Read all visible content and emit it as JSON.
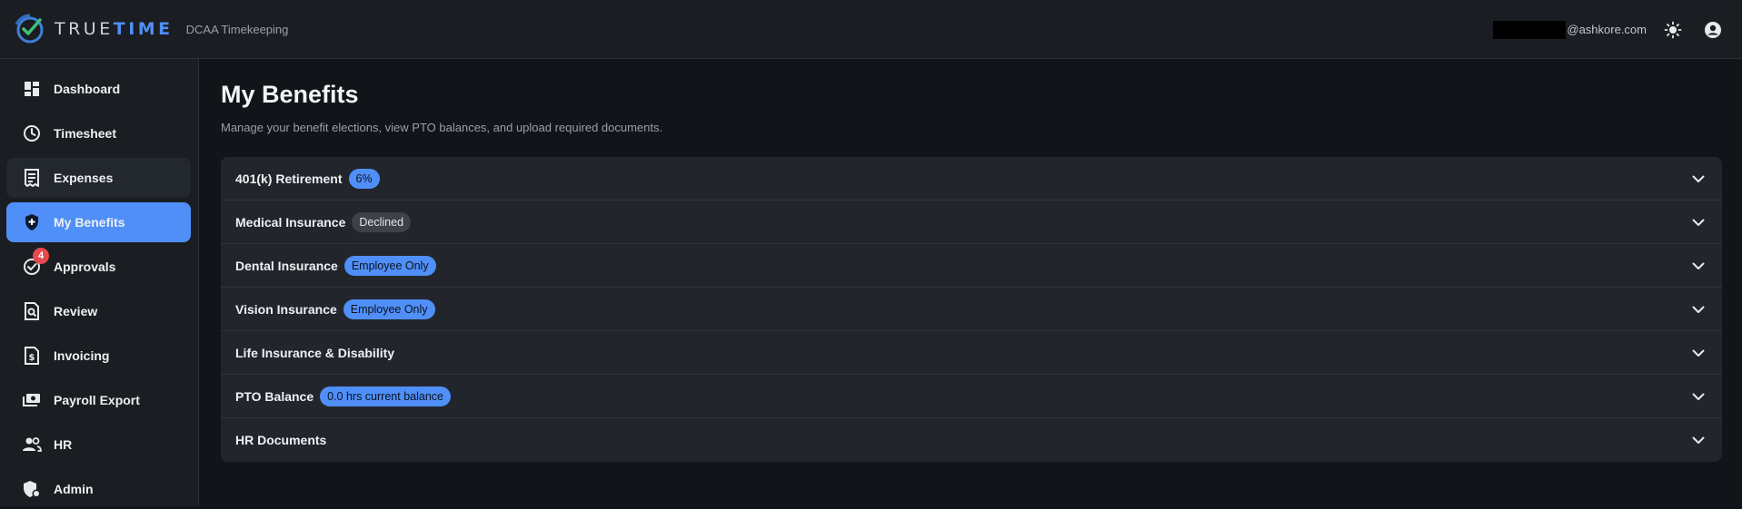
{
  "header": {
    "brand_left": "TRUE",
    "brand_right": "TIME",
    "subtitle": "DCAA Timekeeping",
    "email_domain": "@ashkore.com",
    "accent_color": "#4f8ff7"
  },
  "sidebar": {
    "items": [
      {
        "label": "Dashboard",
        "icon": "dashboard-icon"
      },
      {
        "label": "Timesheet",
        "icon": "clock-icon"
      },
      {
        "label": "Expenses",
        "icon": "receipt-icon"
      },
      {
        "label": "My Benefits",
        "icon": "shield-plus-icon",
        "active": true
      },
      {
        "label": "Approvals",
        "icon": "check-circle-icon",
        "badge": "4"
      },
      {
        "label": "Review",
        "icon": "search-document-icon"
      },
      {
        "label": "Invoicing",
        "icon": "dollar-document-icon"
      },
      {
        "label": "Payroll Export",
        "icon": "money-icon"
      },
      {
        "label": "HR",
        "icon": "people-icon"
      },
      {
        "label": "Admin",
        "icon": "admin-shield-icon"
      }
    ]
  },
  "main": {
    "title": "My Benefits",
    "description": "Manage your benefit elections, view PTO balances, and upload required documents.",
    "sections": [
      {
        "title": "401(k) Retirement",
        "pill": "6%",
        "pill_style": "blue"
      },
      {
        "title": "Medical Insurance",
        "pill": "Declined",
        "pill_style": "gray"
      },
      {
        "title": "Dental Insurance",
        "pill": "Employee Only",
        "pill_style": "blue"
      },
      {
        "title": "Vision Insurance",
        "pill": "Employee Only",
        "pill_style": "blue"
      },
      {
        "title": "Life Insurance & Disability"
      },
      {
        "title": "PTO Balance",
        "pill": "0.0 hrs current balance",
        "pill_style": "blue"
      },
      {
        "title": "HR Documents"
      }
    ]
  }
}
